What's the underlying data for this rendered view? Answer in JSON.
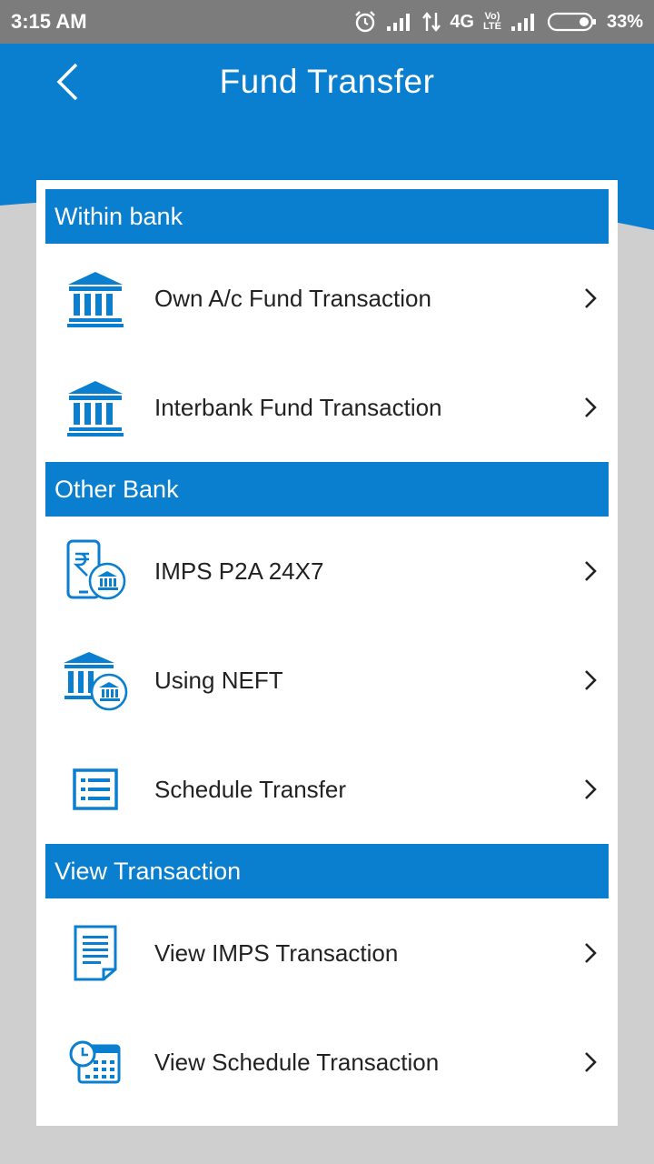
{
  "status_bar": {
    "time": "3:15 AM",
    "network": "4G",
    "volte_top": "Vo)",
    "volte_bottom": "LTE",
    "battery": "33%",
    "battery_level": 0.33
  },
  "header": {
    "title": "Fund Transfer"
  },
  "sections": [
    {
      "label": "Within bank",
      "items": [
        {
          "label": "Own A/c Fund Transaction",
          "icon": "bank-icon"
        },
        {
          "label": "Interbank Fund Transaction",
          "icon": "bank-icon"
        }
      ]
    },
    {
      "label": "Other Bank",
      "items": [
        {
          "label": "IMPS P2A 24X7",
          "icon": "mobile-rupee-bank-icon"
        },
        {
          "label": "Using NEFT",
          "icon": "bank-transfer-icon"
        },
        {
          "label": "Schedule Transfer",
          "icon": "list-icon"
        }
      ]
    },
    {
      "label": "View Transaction",
      "items": [
        {
          "label": "View IMPS Transaction",
          "icon": "document-icon"
        },
        {
          "label": "View Schedule Transaction",
          "icon": "clock-calendar-icon"
        }
      ]
    }
  ],
  "colors": {
    "primary": "#0a7fcf",
    "status_bar": "#7c7c7c",
    "background": "#cfcfcf",
    "card": "#ffffff",
    "text": "#222222"
  }
}
